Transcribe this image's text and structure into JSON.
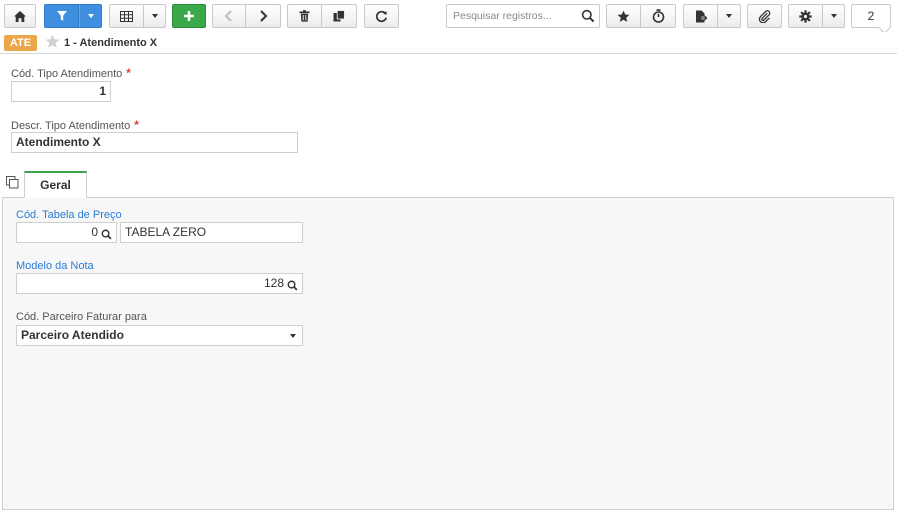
{
  "toolbar": {
    "buttons": [
      {
        "id": "home",
        "icon": "home-icon"
      },
      {
        "id": "filter",
        "icon": "filter-icon",
        "accent": "#3f8fe0"
      },
      {
        "id": "grid",
        "icon": "grid-icon"
      },
      {
        "id": "add",
        "icon": "plus-icon",
        "accent": "#3aa84a"
      },
      {
        "id": "prev",
        "icon": "chevron-left-icon"
      },
      {
        "id": "next",
        "icon": "chevron-right-icon"
      },
      {
        "id": "delete",
        "icon": "trash-icon"
      },
      {
        "id": "duplicate",
        "icon": "copy-icon"
      },
      {
        "id": "refresh",
        "icon": "refresh-icon"
      },
      {
        "id": "favorite",
        "icon": "star-icon"
      },
      {
        "id": "timer",
        "icon": "stopwatch-icon"
      },
      {
        "id": "export",
        "icon": "file-export-icon"
      },
      {
        "id": "attach",
        "icon": "paperclip-icon"
      },
      {
        "id": "settings",
        "icon": "gear-icon"
      }
    ],
    "search_placeholder": "Pesquisar registros...",
    "record_count": "2"
  },
  "breadcrumb": {
    "badge": "ATE",
    "badge_color": "#eba54a",
    "title": "1 - Atendimento X"
  },
  "form": {
    "cod_tipo_label": "Cód. Tipo Atendimento",
    "cod_tipo_value": "1",
    "descr_label": "Descr. Tipo Atendimento",
    "descr_value": "Atendimento X",
    "required_mark": "*"
  },
  "tabs": [
    {
      "label": "Geral",
      "active": true
    }
  ],
  "geral": {
    "tabela_preco_label": "Cód. Tabela de Preço",
    "tabela_preco_code": "0",
    "tabela_preco_desc": "TABELA ZERO",
    "modelo_nota_label": "Modelo da Nota",
    "modelo_nota_value": "128",
    "parceiro_label": "Cód. Parceiro Faturar para",
    "parceiro_value": "Parceiro Atendido"
  },
  "colors": {
    "link_label": "#2b7bd6",
    "required": "#e0402f",
    "active_tab": "#3aa84a"
  }
}
